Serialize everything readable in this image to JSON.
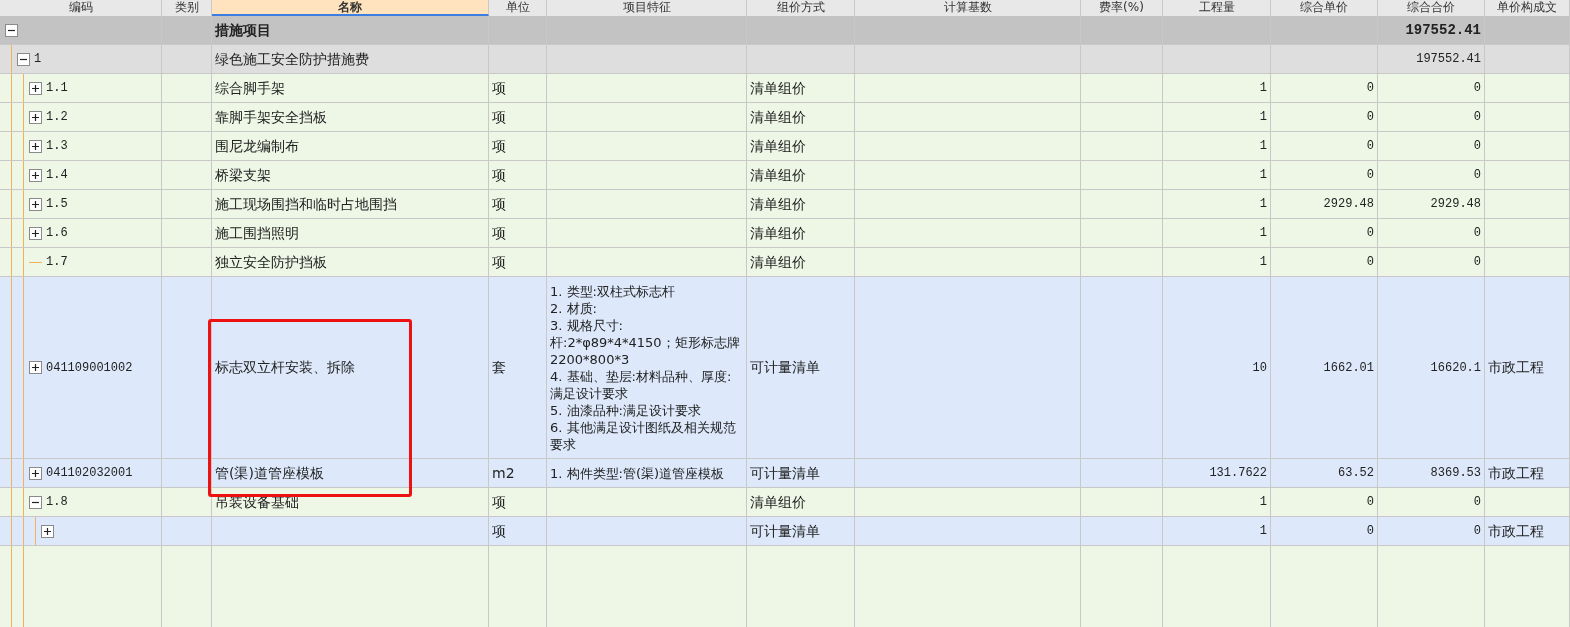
{
  "columns": [
    {
      "label": "编码",
      "selected": false
    },
    {
      "label": "类别",
      "selected": false
    },
    {
      "label": "名称",
      "selected": true
    },
    {
      "label": "单位",
      "selected": false
    },
    {
      "label": "项目特征",
      "selected": false
    },
    {
      "label": "组价方式",
      "selected": false
    },
    {
      "label": "计算基数",
      "selected": false
    },
    {
      "label": "费率(%)",
      "selected": false
    },
    {
      "label": "工程量",
      "selected": false
    },
    {
      "label": "综合单价",
      "selected": false
    },
    {
      "label": "综合合价",
      "selected": false
    },
    {
      "label": "单价构成文",
      "selected": false
    }
  ],
  "rows": [
    {
      "kind": "section",
      "name": "措施项目",
      "expanded": true,
      "total": "197552.41",
      "children": [
        {
          "kind": "group",
          "code": "1",
          "name": "绿色施工安全防护措施费",
          "expanded": true,
          "total": "197552.41",
          "children": [
            {
              "kind": "item",
              "code": "1.1",
              "name": "综合脚手架",
              "unit": "项",
              "pricing": "清单组价",
              "quantity": "1",
              "unit_price": "0",
              "total": "0",
              "expanded": false
            },
            {
              "kind": "item",
              "code": "1.2",
              "name": "靠脚手架安全挡板",
              "unit": "项",
              "pricing": "清单组价",
              "quantity": "1",
              "unit_price": "0",
              "total": "0",
              "expanded": false
            },
            {
              "kind": "item",
              "code": "1.3",
              "name": "围尼龙编制布",
              "unit": "项",
              "pricing": "清单组价",
              "quantity": "1",
              "unit_price": "0",
              "total": "0",
              "expanded": false
            },
            {
              "kind": "item",
              "code": "1.4",
              "name": "桥梁支架",
              "unit": "项",
              "pricing": "清单组价",
              "quantity": "1",
              "unit_price": "0",
              "total": "0",
              "expanded": false
            },
            {
              "kind": "item",
              "code": "1.5",
              "name": "施工现场围挡和临时占地围挡",
              "unit": "项",
              "pricing": "清单组价",
              "quantity": "1",
              "unit_price": "2929.48",
              "total": "2929.48",
              "expanded": false
            },
            {
              "kind": "item",
              "code": "1.6",
              "name": "施工围挡照明",
              "unit": "项",
              "pricing": "清单组价",
              "quantity": "1",
              "unit_price": "0",
              "total": "0",
              "expanded": false
            },
            {
              "kind": "leaf",
              "code": "1.7",
              "name": "独立安全防护挡板",
              "unit": "项",
              "pricing": "清单组价",
              "quantity": "1",
              "unit_price": "0",
              "total": "0"
            },
            {
              "kind": "bill",
              "code": "041109001002",
              "name": "标志双立杆安装、拆除",
              "unit": "套",
              "feature": [
                "1. 类型:双柱式标志杆",
                "2. 材质:",
                "3. 规格尺寸:杆:2*φ89*4*4150；矩形标志牌2200*800*3",
                "4. 基础、垫层:材料品种、厚度:满足设计要求",
                "5. 油漆品种:满足设计要求",
                "6. 其他满足设计图纸及相关规范要求"
              ],
              "pricing": "可计量清单",
              "quantity": "10",
              "unit_price": "1662.01",
              "total": "16620.1",
              "composition": "市政工程",
              "expanded": false
            },
            {
              "kind": "bill",
              "code": "041102032001",
              "name": "管(渠)道管座模板",
              "unit": "m2",
              "feature": [
                "1. 构件类型:管(渠)道管座模板"
              ],
              "pricing": "可计量清单",
              "quantity": "131.7622",
              "unit_price": "63.52",
              "total": "8369.53",
              "composition": "市政工程",
              "expanded": false
            },
            {
              "kind": "item",
              "code": "1.8",
              "name": "吊装设备基础",
              "unit": "项",
              "pricing": "清单组价",
              "quantity": "1",
              "unit_price": "0",
              "total": "0",
              "expanded": true,
              "children": [
                {
                  "kind": "bill",
                  "unit": "项",
                  "pricing": "可计量清单",
                  "quantity": "1",
                  "unit_price": "0",
                  "total": "0",
                  "composition": "市政工程",
                  "expanded": false
                }
              ]
            }
          ]
        }
      ]
    }
  ],
  "highlight": {
    "color": "#ee1111"
  }
}
